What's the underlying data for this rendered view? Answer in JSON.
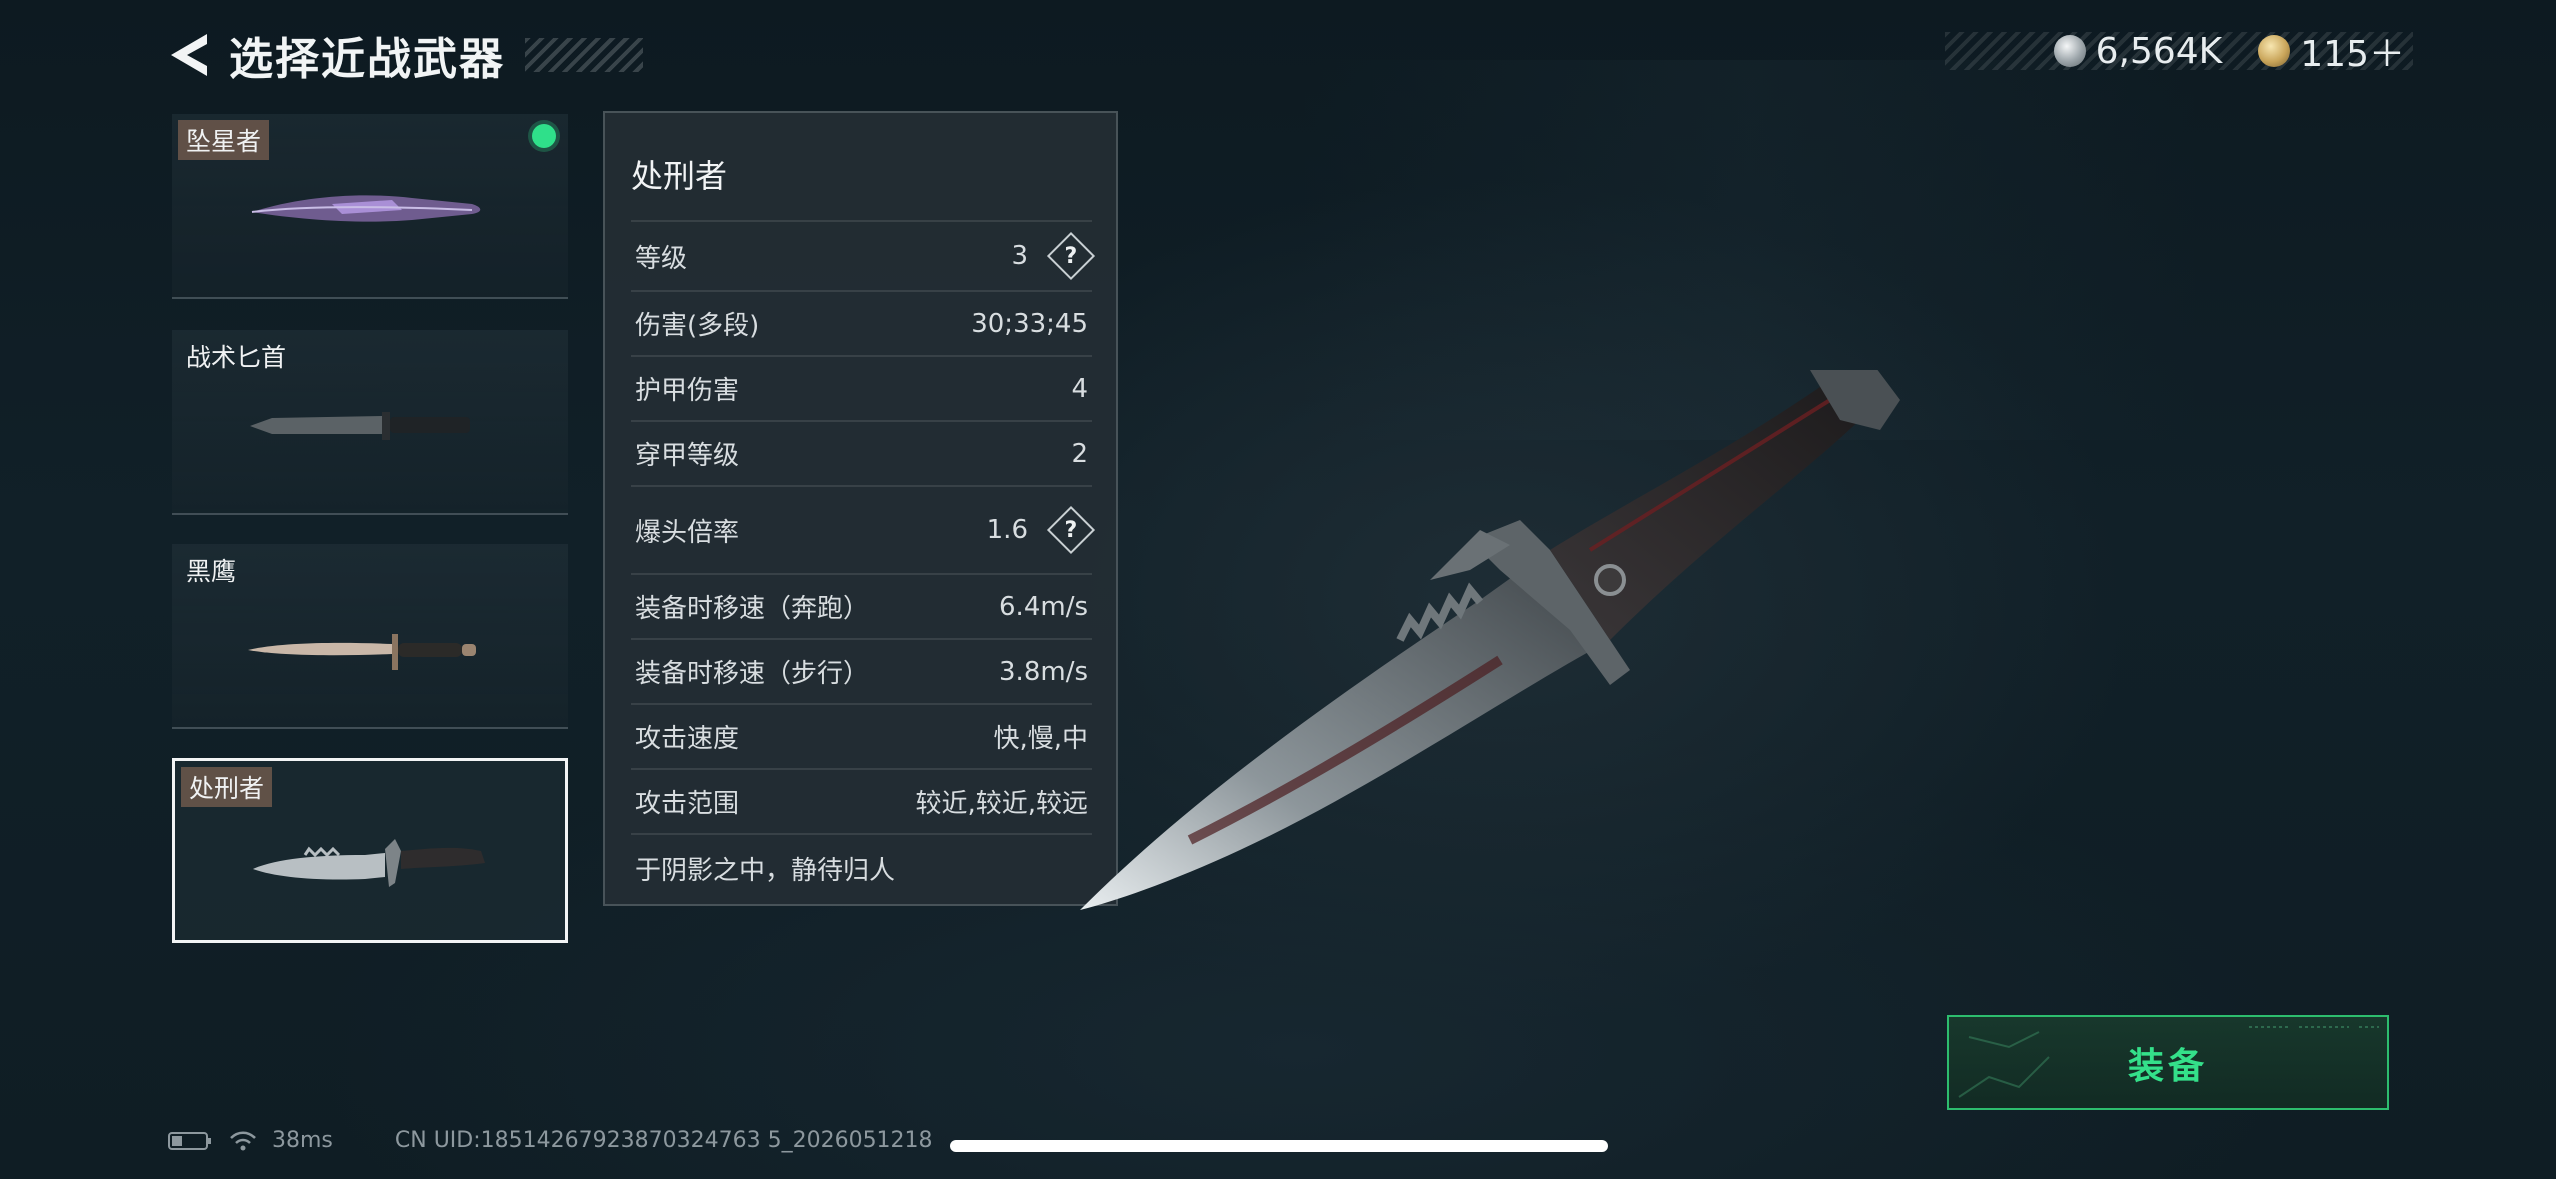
{
  "header": {
    "title": "选择近战武器"
  },
  "currency": {
    "silver": "6,564K",
    "gold": "115＋"
  },
  "weapons": [
    {
      "name": "坠星者",
      "equipped": true
    },
    {
      "name": "战术匕首"
    },
    {
      "name": "黑鹰"
    },
    {
      "name": "处刑者",
      "selected": true
    }
  ],
  "details": {
    "name": "处刑者",
    "stats": [
      {
        "label": "等级",
        "value": "3",
        "help": true
      },
      {
        "label": "伤害(多段)",
        "value": "30;33;45"
      },
      {
        "label": "护甲伤害",
        "value": "4"
      },
      {
        "label": "穿甲等级",
        "value": "2"
      },
      {
        "label": "爆头倍率",
        "value": "1.6",
        "help": true
      },
      {
        "label": "装备时移速（奔跑）",
        "value": "6.4m/s"
      },
      {
        "label": "装备时移速（步行）",
        "value": "3.8m/s"
      },
      {
        "label": "攻击速度",
        "value": "快,慢,中"
      },
      {
        "label": "攻击范围",
        "value": "较近,较近,较远"
      }
    ],
    "flavor": "于阴影之中，静待归人"
  },
  "equip_button": {
    "label": "装备"
  },
  "status_bar": {
    "ping": "38ms",
    "uid": "CN UID:18514267923870324763 5_2026051218"
  },
  "colors": {
    "accent_green": "#34e08a",
    "equipped_dot": "#2fe08a"
  }
}
